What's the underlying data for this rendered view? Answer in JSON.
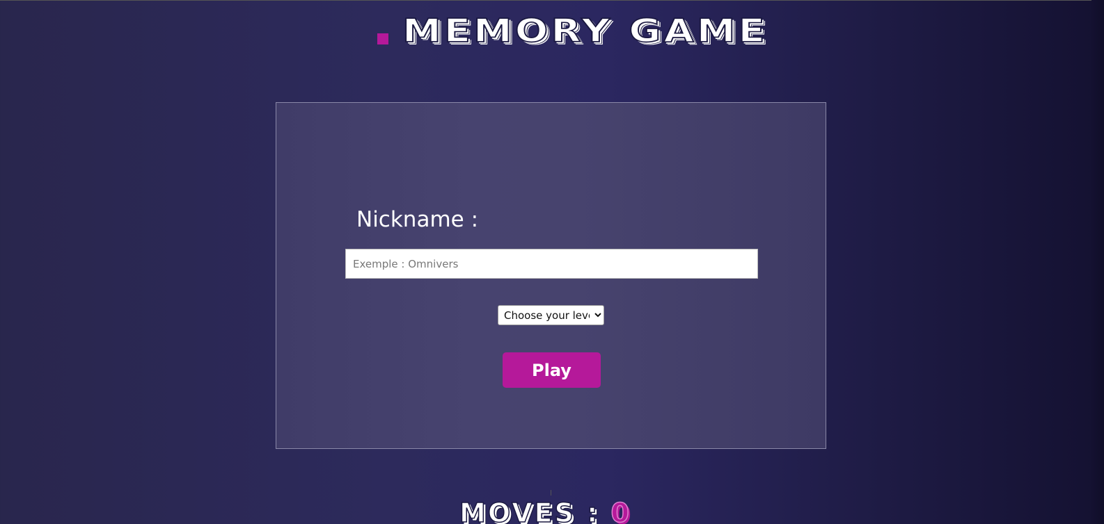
{
  "header": {
    "title": "MEMORY GAME"
  },
  "form": {
    "nickname_label": "Nickname :",
    "nickname_placeholder": "Exemple : Omnivers",
    "level_select": {
      "selected": "Choose your level"
    },
    "play_label": "Play"
  },
  "moves": {
    "label": "MOVES :",
    "count": "0"
  },
  "colors": {
    "accent": "#b5199a",
    "background": "#2b2760",
    "panel": "#45416c"
  }
}
